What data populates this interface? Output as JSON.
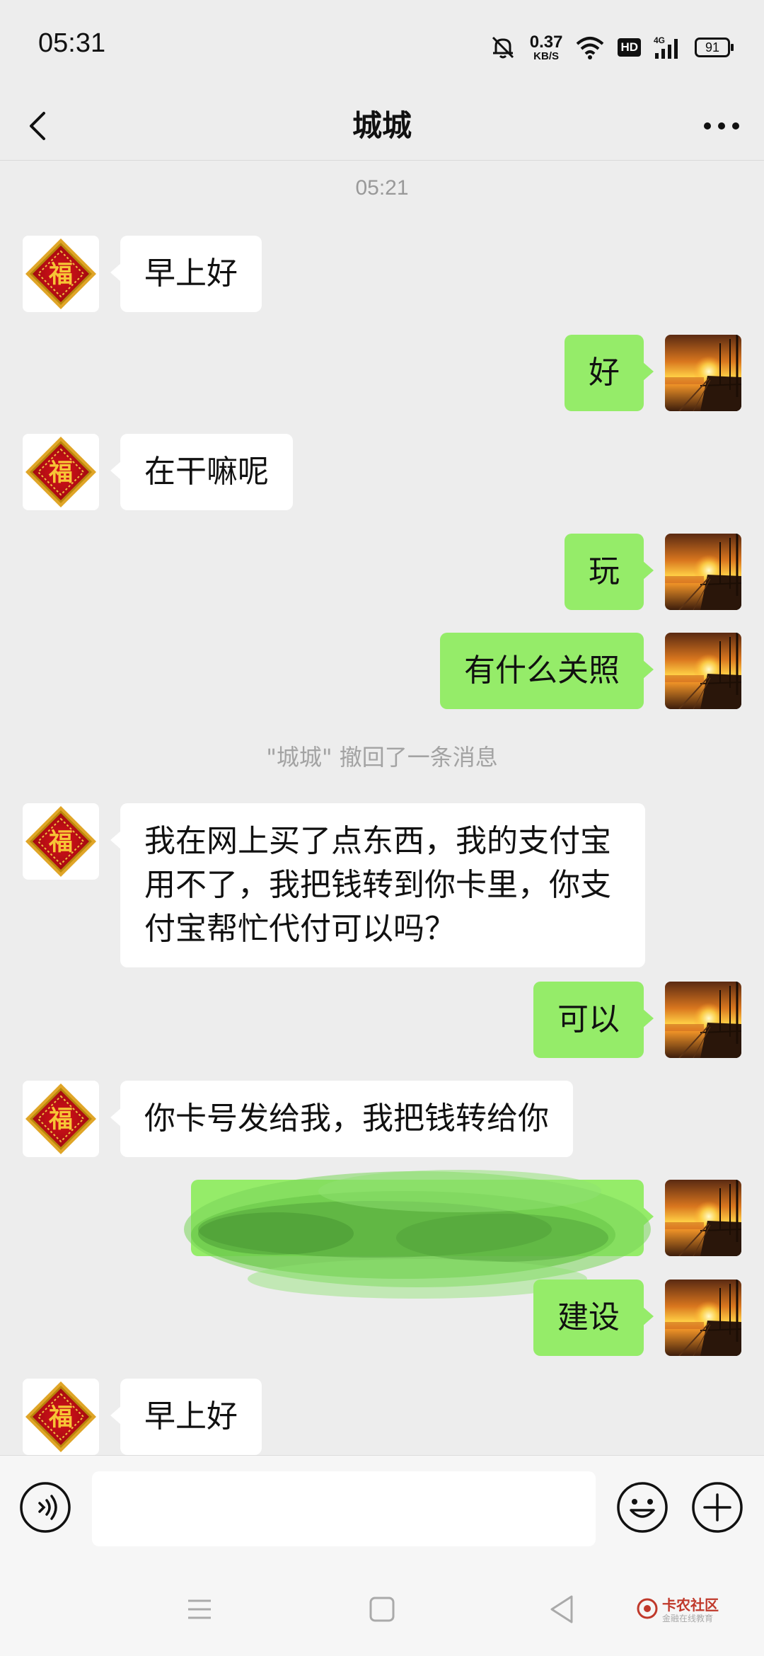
{
  "status_bar": {
    "time": "05:31",
    "net_speed_value": "0.37",
    "net_speed_unit": "KB/S",
    "hd": "HD",
    "network": "4G",
    "battery": "91"
  },
  "header": {
    "title": "城城",
    "back_icon": "chevron-left-icon",
    "more_icon": "more-dots-icon"
  },
  "chat": {
    "timestamp": "05:21",
    "recall_notice": "\"城城\" 撤回了一条消息",
    "messages": [
      {
        "side": "in",
        "text": "早上好"
      },
      {
        "side": "out",
        "text": "好"
      },
      {
        "side": "in",
        "text": "在干嘛呢"
      },
      {
        "side": "out",
        "text": "玩"
      },
      {
        "side": "out",
        "text": "有什么关照"
      },
      {
        "side": "in",
        "text": "我在网上买了点东西，我的支付宝用不了，我把钱转到你卡里，你支付宝帮忙代付可以吗？"
      },
      {
        "side": "out",
        "text": "可以"
      },
      {
        "side": "in",
        "text": "你卡号发给我，我把钱转给你"
      },
      {
        "side": "out",
        "text": "",
        "redacted": true
      },
      {
        "side": "out",
        "text": "建设"
      },
      {
        "side": "in",
        "text": "早上好"
      }
    ]
  },
  "input_bar": {
    "voice_icon": "voice-icon",
    "message_value": "",
    "emoji_icon": "emoji-icon",
    "plus_icon": "plus-icon"
  },
  "watermark": {
    "title": "卡农社区",
    "subtitle": "金融在线教育"
  },
  "colors": {
    "background": "#ededed",
    "incoming_bubble": "#ffffff",
    "outgoing_bubble": "#95ec69",
    "scribble": "#7ad65a"
  }
}
